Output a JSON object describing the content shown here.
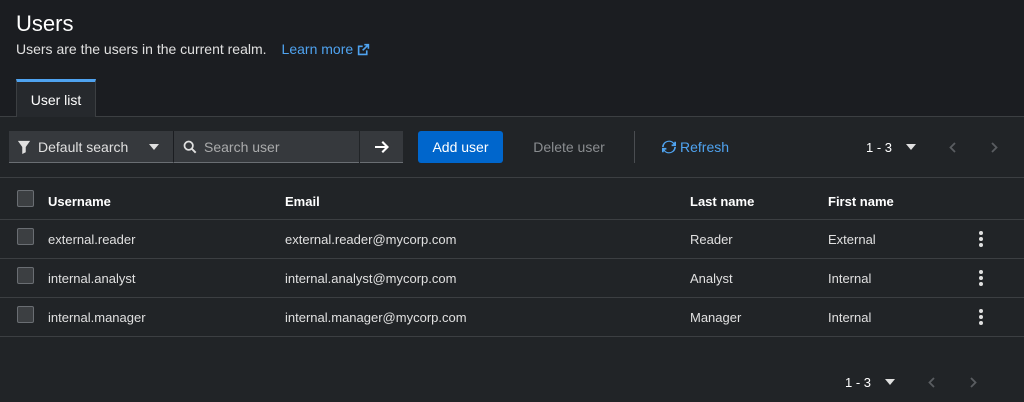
{
  "header": {
    "title": "Users",
    "subtitle": "Users are the users in the current realm.",
    "learn_more": "Learn more"
  },
  "tabs": [
    {
      "label": "User list",
      "active": true
    }
  ],
  "toolbar": {
    "filter_label": "Default search",
    "search_placeholder": "Search user",
    "add_user": "Add user",
    "delete_user": "Delete user",
    "refresh": "Refresh",
    "pagination": "1 - 3"
  },
  "table": {
    "columns": [
      "Username",
      "Email",
      "Last name",
      "First name"
    ],
    "rows": [
      {
        "username": "external.reader",
        "email": "external.reader@mycorp.com",
        "last_name": "Reader",
        "first_name": "External"
      },
      {
        "username": "internal.analyst",
        "email": "internal.analyst@mycorp.com",
        "last_name": "Analyst",
        "first_name": "Internal"
      },
      {
        "username": "internal.manager",
        "email": "internal.manager@mycorp.com",
        "last_name": "Manager",
        "first_name": "Internal"
      }
    ]
  },
  "bottom_pagination": "1 - 3",
  "colors": {
    "background": "#1b1d21",
    "panel": "#212427",
    "primary": "#0066cc",
    "link": "#4fa3f0"
  },
  "icons": {
    "filter": "filter-icon",
    "search": "search-icon",
    "arrow": "arrow-right-icon",
    "refresh": "refresh-icon",
    "external": "external-link-icon",
    "kebab": "kebab-icon"
  }
}
